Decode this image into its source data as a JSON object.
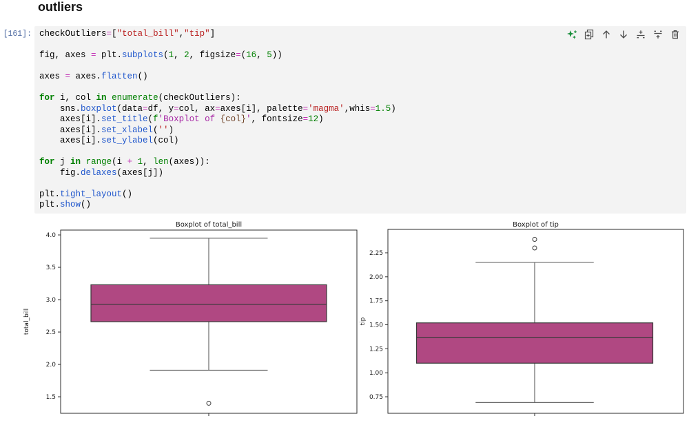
{
  "page": {
    "heading": "outliers"
  },
  "cell": {
    "execution_count": "[161]:",
    "toolbar_icons": [
      "ai-sparkle",
      "duplicate-cell",
      "move-cell-up",
      "move-cell-down",
      "insert-cell-above",
      "insert-cell-below",
      "delete-cell"
    ],
    "accent_colors": {
      "sparkle_green": "#1A8F3C",
      "icon_gray": "#4D4D4D",
      "cell_background": "#F3F3F3",
      "prompt_color": "#546FA5"
    },
    "code_lines": [
      [
        [
          "pl",
          "checkOutliers"
        ],
        [
          "op",
          "="
        ],
        [
          "pl",
          "["
        ],
        [
          "st",
          "\"total_bill\""
        ],
        [
          "pl",
          ","
        ],
        [
          "st",
          "\"tip\""
        ],
        [
          "pl",
          "]"
        ]
      ],
      [],
      [
        [
          "pl",
          "fig, axes "
        ],
        [
          "op",
          "="
        ],
        [
          "pl",
          " plt."
        ],
        [
          "fn",
          "subplots"
        ],
        [
          "pl",
          "("
        ],
        [
          "nu",
          "1"
        ],
        [
          "pl",
          ", "
        ],
        [
          "nu",
          "2"
        ],
        [
          "pl",
          ", figsize"
        ],
        [
          "op",
          "="
        ],
        [
          "pl",
          "("
        ],
        [
          "nu",
          "16"
        ],
        [
          "pl",
          ", "
        ],
        [
          "nu",
          "5"
        ],
        [
          "pl",
          "))"
        ]
      ],
      [],
      [
        [
          "pl",
          "axes "
        ],
        [
          "op",
          "="
        ],
        [
          "pl",
          " axes."
        ],
        [
          "fn",
          "flatten"
        ],
        [
          "pl",
          "()"
        ]
      ],
      [],
      [
        [
          "kw",
          "for"
        ],
        [
          "pl",
          " i, col "
        ],
        [
          "kw",
          "in"
        ],
        [
          "pl",
          " "
        ],
        [
          "bi",
          "enumerate"
        ],
        [
          "pl",
          "(checkOutliers):"
        ]
      ],
      [
        [
          "pl",
          "    sns."
        ],
        [
          "fn",
          "boxplot"
        ],
        [
          "pl",
          "(data"
        ],
        [
          "op",
          "="
        ],
        [
          "pl",
          "df, y"
        ],
        [
          "op",
          "="
        ],
        [
          "pl",
          "col, ax"
        ],
        [
          "op",
          "="
        ],
        [
          "pl",
          "axes[i], palette"
        ],
        [
          "op",
          "="
        ],
        [
          "st",
          "'magma'"
        ],
        [
          "pl",
          ",whis"
        ],
        [
          "op",
          "="
        ],
        [
          "nu",
          "1.5"
        ],
        [
          "pl",
          ")"
        ]
      ],
      [
        [
          "pl",
          "    axes[i]."
        ],
        [
          "fn",
          "set_title"
        ],
        [
          "pl",
          "("
        ],
        [
          "fp",
          "f"
        ],
        [
          "fs",
          "'Boxplot of "
        ],
        [
          "fe",
          "{col}"
        ],
        [
          "fs",
          "'"
        ],
        [
          "pl",
          ", fontsize"
        ],
        [
          "op",
          "="
        ],
        [
          "nu",
          "12"
        ],
        [
          "pl",
          ")"
        ]
      ],
      [
        [
          "pl",
          "    axes[i]."
        ],
        [
          "fn",
          "set_xlabel"
        ],
        [
          "pl",
          "("
        ],
        [
          "st",
          "''"
        ],
        [
          "pl",
          ")"
        ]
      ],
      [
        [
          "pl",
          "    axes[i]."
        ],
        [
          "fn",
          "set_ylabel"
        ],
        [
          "pl",
          "(col)"
        ]
      ],
      [],
      [
        [
          "kw",
          "for"
        ],
        [
          "pl",
          " j "
        ],
        [
          "kw",
          "in"
        ],
        [
          "pl",
          " "
        ],
        [
          "bi",
          "range"
        ],
        [
          "pl",
          "(i "
        ],
        [
          "op",
          "+"
        ],
        [
          "pl",
          " "
        ],
        [
          "nu",
          "1"
        ],
        [
          "pl",
          ", "
        ],
        [
          "bi",
          "len"
        ],
        [
          "pl",
          "(axes)):"
        ]
      ],
      [
        [
          "pl",
          "    fig."
        ],
        [
          "fn",
          "delaxes"
        ],
        [
          "pl",
          "(axes[j])"
        ]
      ],
      [],
      [
        [
          "pl",
          "plt."
        ],
        [
          "fn",
          "tight_layout"
        ],
        [
          "pl",
          "()"
        ]
      ],
      [
        [
          "pl",
          "plt."
        ],
        [
          "fn",
          "show"
        ],
        [
          "pl",
          "()"
        ]
      ]
    ]
  },
  "chart_data": [
    {
      "type": "boxplot",
      "title": "Boxplot of total_bill",
      "ylabel": "total_bill",
      "xlabel": "",
      "yticks": [
        "1.5",
        "2.0",
        "2.5",
        "3.0",
        "3.5",
        "4.0"
      ],
      "ylim": [
        1.245,
        4.075
      ],
      "grid": false,
      "stats": {
        "whislo": 1.91,
        "q1": 2.66,
        "med": 2.93,
        "q3": 3.23,
        "whishi": 3.95,
        "fliers": [
          1.4
        ]
      },
      "box_fill": "#B04882",
      "box_edge": "#3A3A3A",
      "whisker_color": "#6A6A6A",
      "spine_color": "#2B2B2B"
    },
    {
      "type": "boxplot",
      "title": "Boxplot of tip",
      "ylabel": "tip",
      "xlabel": "",
      "yticks": [
        "0.75",
        "1.00",
        "1.25",
        "1.50",
        "1.75",
        "2.00",
        "2.25"
      ],
      "ylim": [
        0.578,
        2.494
      ],
      "grid": false,
      "stats": {
        "whislo": 0.69,
        "q1": 1.1,
        "med": 1.37,
        "q3": 1.52,
        "whishi": 2.15,
        "fliers": [
          2.3,
          2.39
        ]
      },
      "box_fill": "#B04882",
      "box_edge": "#3A3A3A",
      "whisker_color": "#6A6A6A",
      "spine_color": "#2B2B2B"
    }
  ]
}
